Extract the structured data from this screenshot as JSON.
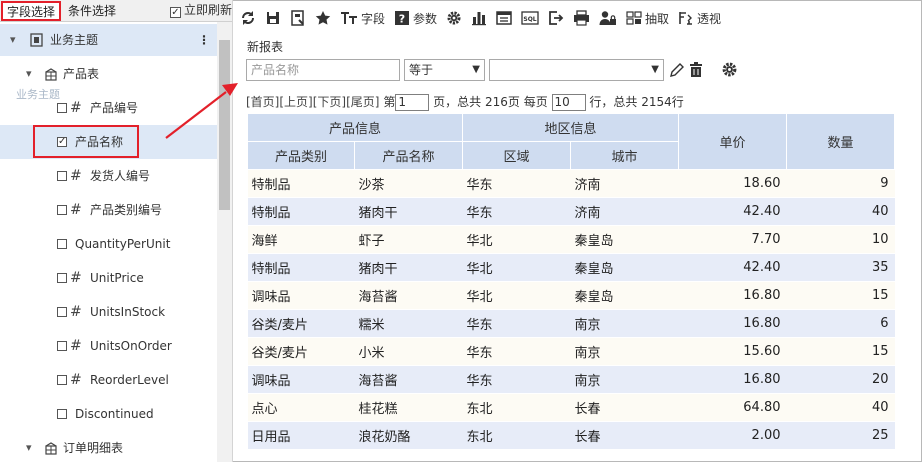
{
  "left_panel": {
    "tabs": {
      "field_select": "字段选择",
      "condition_select": "条件选择"
    },
    "auto_refresh": "立即刷新",
    "tree": {
      "theme_label": "业务主题",
      "ghost_label": "业务主题",
      "table1": "产品表",
      "fields": [
        {
          "label": "产品编号"
        },
        {
          "label": "产品名称",
          "checked": true
        },
        {
          "label": "发货人编号"
        },
        {
          "label": "产品类别编号"
        },
        {
          "label": "QuantityPerUnit"
        },
        {
          "label": "UnitPrice"
        },
        {
          "label": "UnitsInStock"
        },
        {
          "label": "UnitsOnOrder"
        },
        {
          "label": "ReorderLevel"
        },
        {
          "label": "Discontinued"
        }
      ],
      "table2": "订单明细表"
    }
  },
  "toolbar": {
    "field_label": "字段",
    "param_label": "参数",
    "extract_label": "抽取",
    "pivot_label": "透视",
    "sql_label": "SQL"
  },
  "report_name": "新报表",
  "filter": {
    "field_placeholder": "产品名称",
    "operator": "等于",
    "value": ""
  },
  "pager": {
    "first": "[首页]",
    "prev": "[上页]",
    "next": "[下页]",
    "last": "[尾页]",
    "page_prefix": "第",
    "page": "1",
    "page_mid": "页，总共 216页 每页",
    "per_page": "10",
    "rows_suffix": "行，总共 2154行"
  },
  "table": {
    "group_headers": {
      "product_info": "产品信息",
      "region_info": "地区信息",
      "price": "单价",
      "qty": "数量"
    },
    "columns": [
      "产品类别",
      "产品名称",
      "区域",
      "城市"
    ],
    "rows": [
      [
        "特制品",
        "沙茶",
        "华东",
        "济南",
        "18.60",
        "9"
      ],
      [
        "特制品",
        "猪肉干",
        "华东",
        "济南",
        "42.40",
        "40"
      ],
      [
        "海鲜",
        "虾子",
        "华北",
        "秦皇岛",
        "7.70",
        "10"
      ],
      [
        "特制品",
        "猪肉干",
        "华北",
        "秦皇岛",
        "42.40",
        "35"
      ],
      [
        "调味品",
        "海苔酱",
        "华北",
        "秦皇岛",
        "16.80",
        "15"
      ],
      [
        "谷类/麦片",
        "糯米",
        "华东",
        "南京",
        "16.80",
        "6"
      ],
      [
        "谷类/麦片",
        "小米",
        "华东",
        "南京",
        "15.60",
        "15"
      ],
      [
        "调味品",
        "海苔酱",
        "华东",
        "南京",
        "16.80",
        "20"
      ],
      [
        "点心",
        "桂花糕",
        "东北",
        "长春",
        "64.80",
        "40"
      ],
      [
        "日用品",
        "浪花奶酪",
        "东北",
        "长春",
        "2.00",
        "25"
      ]
    ]
  },
  "colors": {
    "highlight_red": "#e3202a",
    "header_blue": "#cfdcf0",
    "row_alt": "#e7ecf8",
    "row_base": "#fdfbf4"
  }
}
